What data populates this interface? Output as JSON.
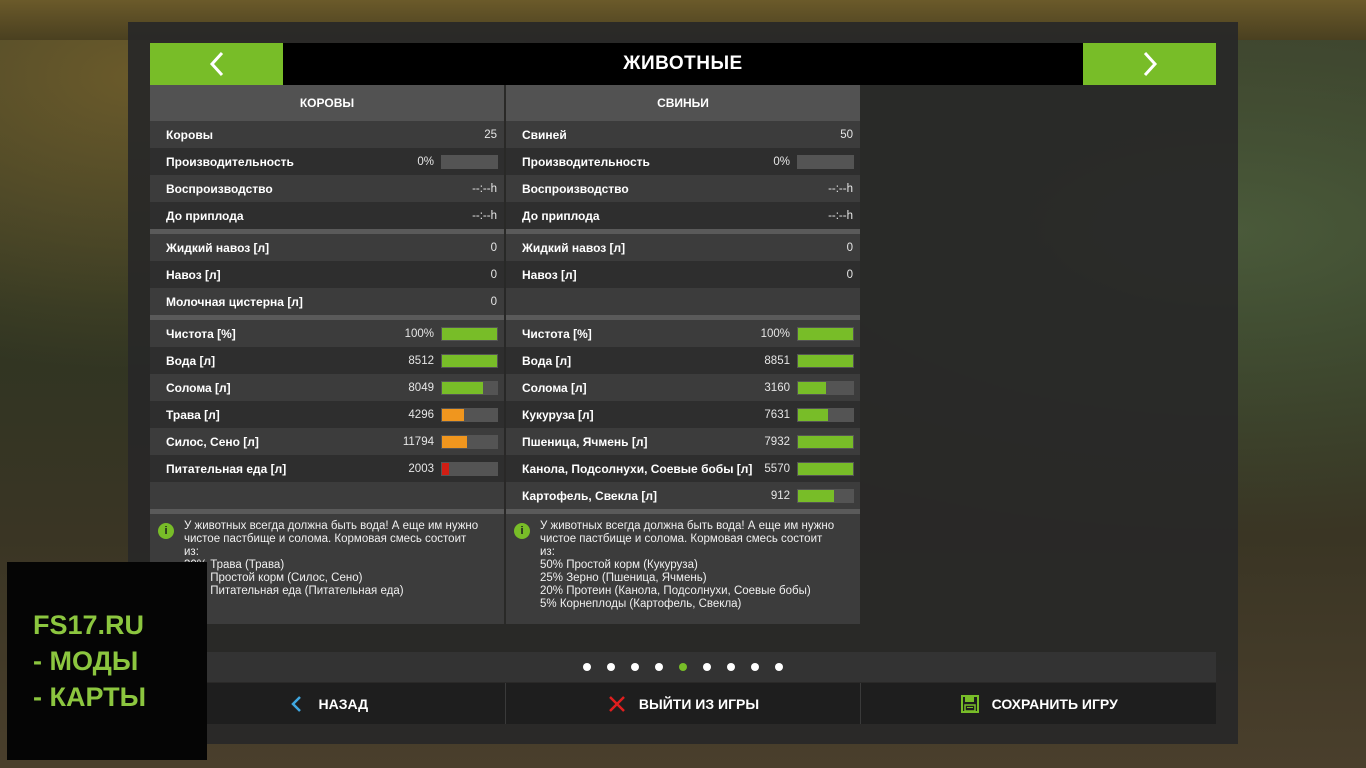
{
  "header": {
    "title": "ЖИВОТНЫЕ"
  },
  "colors": {
    "accent_green": "#78bd28",
    "warn_orange": "#f0961e",
    "danger_red": "#d11e14"
  },
  "left": {
    "title": "КОРОВЫ",
    "stats": [
      {
        "label": "Коровы",
        "value": "25"
      },
      {
        "label": "Производительность",
        "value": "0%",
        "fill": 0
      },
      {
        "label": "Воспроизводство",
        "value": "--:--h"
      },
      {
        "label": "До приплода",
        "value": "--:--h"
      }
    ],
    "products": [
      {
        "label": "Жидкий навоз [л]",
        "value": "0"
      },
      {
        "label": "Навоз [л]",
        "value": "0"
      },
      {
        "label": "Молочная цистерна [л]",
        "value": "0"
      }
    ],
    "feed": [
      {
        "label": "Чистота [%]",
        "value": "100%",
        "fill": 1.0,
        "color": "green"
      },
      {
        "label": "Вода [л]",
        "value": "8512",
        "fill": 1.0,
        "color": "green"
      },
      {
        "label": "Солома [л]",
        "value": "8049",
        "fill": 0.75,
        "color": "green"
      },
      {
        "label": "Трава [л]",
        "value": "4296",
        "fill": 0.4,
        "color": "orange"
      },
      {
        "label": "Силос, Сено [л]",
        "value": "11794",
        "fill": 0.45,
        "color": "orange"
      },
      {
        "label": "Питательная еда [л]",
        "value": "2003",
        "fill": 0.12,
        "color": "red"
      }
    ],
    "tip": [
      "У животных всегда должна быть вода! А еще им нужно",
      "чистое пастбище и солома. Кормовая смесь состоит",
      "из:",
      "30% Трава (Трава)",
      "50% Простой корм (Силос, Сено)",
      "20% Питательная еда (Питательная еда)"
    ]
  },
  "right": {
    "title": "СВИНЬИ",
    "stats": [
      {
        "label": "Свиней",
        "value": "50"
      },
      {
        "label": "Производительность",
        "value": "0%",
        "fill": 0
      },
      {
        "label": "Воспроизводство",
        "value": "--:--h"
      },
      {
        "label": "До приплода",
        "value": "--:--h"
      }
    ],
    "products": [
      {
        "label": "Жидкий навоз [л]",
        "value": "0"
      },
      {
        "label": "Навоз [л]",
        "value": "0"
      }
    ],
    "feed": [
      {
        "label": "Чистота [%]",
        "value": "100%",
        "fill": 1.0,
        "color": "green"
      },
      {
        "label": "Вода [л]",
        "value": "8851",
        "fill": 1.0,
        "color": "green"
      },
      {
        "label": "Солома [л]",
        "value": "3160",
        "fill": 0.5,
        "color": "green"
      },
      {
        "label": "Кукуруза [л]",
        "value": "7631",
        "fill": 0.55,
        "color": "green"
      },
      {
        "label": "Пшеница, Ячмень [л]",
        "value": "7932",
        "fill": 1.0,
        "color": "green"
      },
      {
        "label": "Канола, Подсолнухи, Соевые бобы [л]",
        "value": "5570",
        "fill": 1.0,
        "color": "green"
      },
      {
        "label": "Картофель, Свекла [л]",
        "value": "912",
        "fill": 0.65,
        "color": "green"
      }
    ],
    "tip": [
      "У животных всегда должна быть вода! А еще им нужно",
      "чистое пастбище и солома. Кормовая смесь состоит",
      "из:",
      "50% Простой корм (Кукуруза)",
      "25% Зерно (Пшеница, Ячмень)",
      "20% Протеин (Канола, Подсолнухи, Соевые бобы)",
      "5% Корнеплоды (Картофель, Свекла)"
    ]
  },
  "pager": {
    "count": 9,
    "active_index": 4
  },
  "bottom": {
    "back_label": "НАЗАД",
    "quit_label": "ВЫЙТИ ИЗ ИГРЫ",
    "save_label": "СОХРАНИТЬ ИГРУ"
  },
  "watermark": {
    "line1": "FS17.RU",
    "line2": "- МОДЫ",
    "line3": "- КАРТЫ"
  }
}
